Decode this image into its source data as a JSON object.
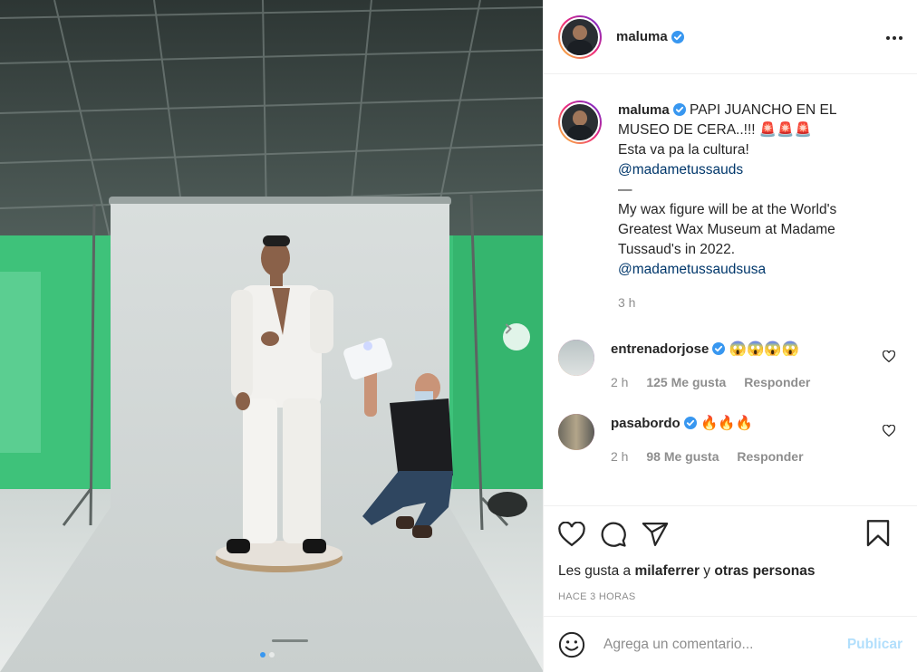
{
  "post": {
    "username": "maluma",
    "verified": true,
    "caption": {
      "line1": "PAPI JUANCHO EN EL",
      "line2": "MUSEO DE CERA..!!!",
      "emoji": "🚨🚨🚨",
      "line3": "Esta va pa la cultura!",
      "mention1": "@madametussauds",
      "divider": "—",
      "line4": "My wax figure will be at the World's",
      "line5": "Greatest Wax Museum at Madame",
      "line6": "Tussaud's in 2022.",
      "mention2": "@madametussaudsusa"
    },
    "time": "3 h"
  },
  "comments": [
    {
      "username": "entrenadorjose",
      "text": "😱😱😱😱",
      "time": "2 h",
      "likes": "125 Me gusta",
      "reply": "Responder"
    },
    {
      "username": "pasabordo",
      "text": "🔥🔥🔥",
      "time": "2 h",
      "likes": "98 Me gusta",
      "reply": "Responder"
    }
  ],
  "actions": {
    "likes_prefix": "Les gusta a",
    "likes_user": "milaferrer",
    "likes_and": "y",
    "likes_others": "otras personas",
    "ago": "HACE 3 HORAS"
  },
  "add_comment": {
    "placeholder": "Agrega un comentario...",
    "publish": "Publicar"
  },
  "carousel": {
    "total": 2,
    "current": 1
  },
  "colors": {
    "verified": "#3897f0",
    "mention": "#00376b",
    "publish_disabled": "#b2dffc",
    "backdrop_green": "#3ec27a"
  }
}
